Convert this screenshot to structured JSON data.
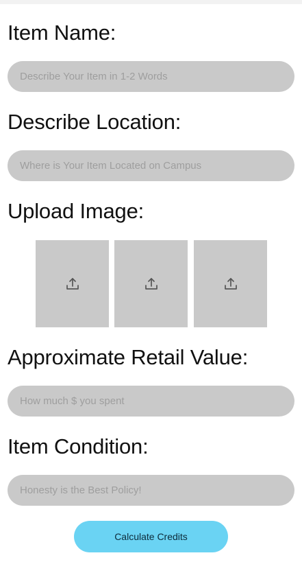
{
  "form": {
    "item_name": {
      "label": "Item Name:",
      "placeholder": "Describe Your Item in 1-2 Words",
      "value": ""
    },
    "location": {
      "label": "Describe Location:",
      "placeholder": "Where is Your Item Located on Campus",
      "value": ""
    },
    "upload": {
      "label": "Upload Image:",
      "tiles": [
        {
          "icon": "upload-icon"
        },
        {
          "icon": "upload-icon"
        },
        {
          "icon": "upload-icon"
        }
      ]
    },
    "retail_value": {
      "label": "Approximate Retail Value:",
      "placeholder": "How much $ you spent",
      "value": ""
    },
    "condition": {
      "label": "Item Condition:",
      "placeholder": "Honesty is the Best Policy!",
      "value": ""
    }
  },
  "actions": {
    "calculate_label": "Calculate Credits"
  },
  "colors": {
    "field_bg": "#c9c9c9",
    "button_bg": "#6ad3f3",
    "text": "#111111",
    "placeholder": "#9e9e9e"
  }
}
